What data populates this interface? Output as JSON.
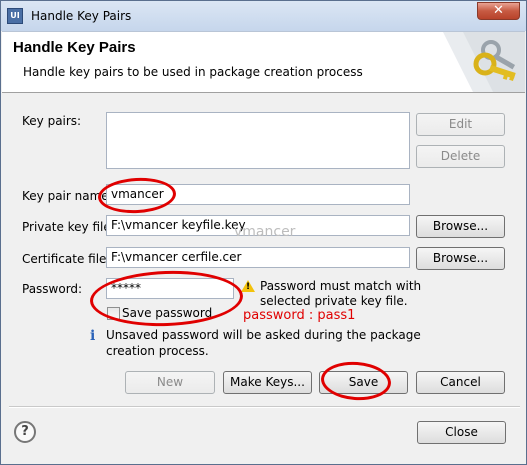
{
  "window": {
    "title": "Handle Key Pairs",
    "icon": "UI",
    "close_glyph": "✕"
  },
  "banner": {
    "title": "Handle Key Pairs",
    "description": "Handle key pairs to be used in package creation process"
  },
  "key_pairs": {
    "label": "Key pairs:",
    "edit_label": "Edit",
    "delete_label": "Delete"
  },
  "key_pair_name": {
    "label": "Key pair name:",
    "value": "vmancer"
  },
  "private_key": {
    "label": "Private key file:",
    "value": "F:\\vmancer keyfile.key",
    "browse_label": "Browse..."
  },
  "certificate": {
    "label": "Certificate file:",
    "value": "F:\\vmancer cerfile.cer",
    "browse_label": "Browse..."
  },
  "password": {
    "label": "Password:",
    "value": "*****",
    "warning_line1": "Password must match with",
    "warning_line2": "selected private key file.",
    "save_password_label": "Save password",
    "save_password_checked": false
  },
  "info": {
    "line1": "Unsaved password will be asked during the package",
    "line2": "creation process."
  },
  "actions": {
    "new_label": "New",
    "make_keys_label": "Make Keys...",
    "save_label": "Save",
    "cancel_label": "Cancel",
    "close_label": "Close"
  },
  "annotations": {
    "watermark": "vmancer",
    "password_note": "password : pass1",
    "highlight_color": "#e00000"
  },
  "icons": {
    "title": "app-icon",
    "banner": "keys-icon",
    "warning": "warning-icon",
    "info": "info-icon",
    "help": "help-icon"
  }
}
